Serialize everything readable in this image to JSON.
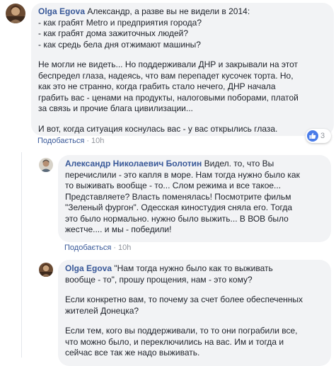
{
  "comments": [
    {
      "author": "Olga Egova",
      "lines": [
        "Александр, а разве вы не видели в 2014:",
        "- как грабят Metro и предприятия города?",
        "- как грабят дома зажиточных людей?",
        "- как средь бела дня отжимают машины?"
      ],
      "paragraphs": [
        [
          "Не могли не видеть... Но поддерживали ДНР и закрывали на этот",
          "беспредел глаза, надеясь, что вам перепадет кусочек торта. Но,",
          "как это не странно, когда грабить стало нечего, ДНР начала",
          "грабить вас - ценами на продукты, налоговыми поборами, платой",
          "за связь и прочие блага цивилизации..."
        ],
        [
          "И вот, когда ситуация коснулась вас - у вас открылись глаза."
        ]
      ],
      "like_label": "Подобається",
      "time": "10h",
      "reaction_count": "3",
      "reaction_icon": "thumbs-up-icon"
    },
    {
      "author": "Александр Николаевич Болотин",
      "lines": [
        "Видел. то, что Вы",
        "перечислили - это капля в море. Нам тогда нужно было как",
        "то выживать вообще - то... Слом режима и все такое...",
        "Представляете? Власть поменялась! Посмотрите фильм",
        "\"Зеленый фургон\". Одесская киностудия сняла его. Тогда",
        "это было нормально. нужно было выжить... В ВОВ было",
        "жестче.... и мы - победили!"
      ],
      "like_label": "Подобається",
      "time": "10h"
    },
    {
      "author": "Olga Egova",
      "lines": [
        "\"Нам тогда нужно было как то выживать",
        "вообще - то\", прошу прощения, нам - это кому?"
      ],
      "paragraphs": [
        [
          "Если конкретно вам, то почему за счет более обеспеченных",
          "жителей Донецка?"
        ],
        [
          "Если тем, кого вы поддерживали, то то они пограбили все,",
          "что можно было, и переключились на вас. Им и тогда и",
          "сейчас все так же надо выживать."
        ]
      ]
    }
  ],
  "colors": {
    "bubble": "#f2f3f5",
    "author": "#385898",
    "text": "#1d2129",
    "meta": "#90949c",
    "like_badge": "#4a7ce9"
  }
}
